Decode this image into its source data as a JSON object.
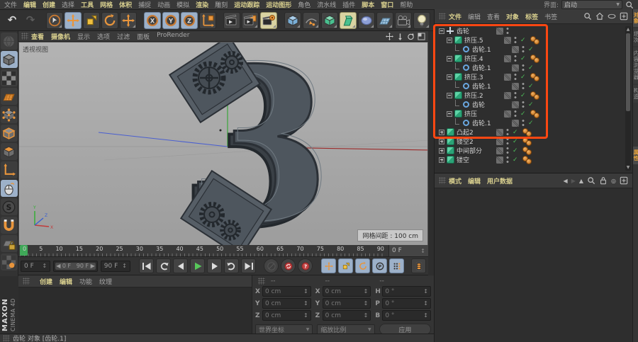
{
  "icons": {
    "undo": "↶",
    "redo": "↷",
    "stepper": "↕",
    "dropdown": "▼",
    "back": "◀",
    "forward": "▶",
    "up": "▲",
    "target": "◎",
    "range_left": "◀",
    "range_right": "▶"
  },
  "colors": {
    "accent": "#e8953c",
    "selection_blue": "#9db1c9",
    "annotation": "#ff4712",
    "check_green": "#4dbb58",
    "canvas_gray": "#a8a8a8"
  },
  "menubar": {
    "items": [
      {
        "label": "文件",
        "em": false
      },
      {
        "label": "编辑",
        "em": true
      },
      {
        "label": "创建",
        "em": true
      },
      {
        "label": "选择",
        "em": false
      },
      {
        "label": "工具",
        "em": true
      },
      {
        "label": "网格",
        "em": true
      },
      {
        "label": "体积",
        "em": true
      },
      {
        "label": "捕捉",
        "em": false
      },
      {
        "label": "动画",
        "em": false
      },
      {
        "label": "模拟",
        "em": false
      },
      {
        "label": "渲染",
        "em": true
      },
      {
        "label": "雕刻",
        "em": false
      },
      {
        "label": "运动跟踪",
        "em": true
      },
      {
        "label": "运动图形",
        "em": true
      },
      {
        "label": "角色",
        "em": false
      },
      {
        "label": "流水线",
        "em": false
      },
      {
        "label": "插件",
        "em": false
      },
      {
        "label": "脚本",
        "em": true
      },
      {
        "label": "窗口",
        "em": true
      },
      {
        "label": "帮助",
        "em": false
      }
    ],
    "interface_label": "界面:",
    "interface_value": "启动"
  },
  "toolbar": {
    "buttons": [
      {
        "name": "undo-button",
        "glyph": "↶",
        "plain": true
      },
      {
        "name": "redo-button",
        "glyph": "↷",
        "plain": true,
        "dim": true
      },
      {
        "name": "live-selection-button",
        "icon": "cursor",
        "gap": true,
        "fly": true
      },
      {
        "name": "move-button",
        "icon": "move",
        "active": true
      },
      {
        "name": "scale-button",
        "icon": "scale"
      },
      {
        "name": "rotate-button",
        "icon": "rotate"
      },
      {
        "name": "last-tool-button",
        "icon": "move",
        "fly": true
      },
      {
        "name": "lock-x-button",
        "icon": "axisX",
        "active": true,
        "gap": true
      },
      {
        "name": "lock-y-button",
        "icon": "axisY",
        "active": true
      },
      {
        "name": "lock-z-button",
        "icon": "axisZ",
        "active": true
      },
      {
        "name": "coord-system-button",
        "icon": "coordsys"
      },
      {
        "name": "render-view-button",
        "icon": "clapper",
        "gap": true
      },
      {
        "name": "render-picture-viewer-button",
        "icon": "clapperPV",
        "fly": true
      },
      {
        "name": "render-settings-button",
        "icon": "clapperRS",
        "warm": true,
        "fly": true
      },
      {
        "name": "add-primitive-button",
        "icon": "cubeBlue",
        "gap": true,
        "fly": true
      },
      {
        "name": "add-spline-button",
        "icon": "pen",
        "fly": true
      },
      {
        "name": "add-generator-button",
        "icon": "cubeGreen",
        "fly": true
      },
      {
        "name": "add-deformer-button",
        "icon": "deformer",
        "warm": true,
        "fly": true
      },
      {
        "name": "add-field-button",
        "icon": "field",
        "fly": true
      },
      {
        "name": "add-floor-button",
        "icon": "floor",
        "fly": true
      },
      {
        "name": "add-camera-button",
        "icon": "camera",
        "fly": true
      },
      {
        "name": "add-light-button",
        "icon": "light",
        "fly": true
      }
    ]
  },
  "left_palette": {
    "items": [
      {
        "name": "make-editable-button",
        "icon": "ballDim"
      },
      {
        "name": "model-mode-button",
        "icon": "cubeGray",
        "active": true
      },
      {
        "name": "texture-mode-button",
        "icon": "checker"
      },
      {
        "name": "workplane-mode-button",
        "icon": "wplane"
      },
      {
        "name": "points-mode-button",
        "icon": "cubePts"
      },
      {
        "name": "edges-mode-button",
        "icon": "cubeEdge"
      },
      {
        "name": "polygons-mode-button",
        "icon": "cubeFace"
      },
      {
        "name": "enable-axis-button",
        "icon": "axisL"
      },
      {
        "name": "viewport-solo-button",
        "icon": "mouse",
        "active": true
      },
      {
        "name": "enable-snap-button",
        "icon": "sball"
      },
      {
        "name": "magnet-button",
        "icon": "magnet"
      },
      {
        "name": "lock-workplane-button",
        "icon": "lockgrid"
      },
      {
        "name": "paint-setup-button",
        "icon": "paint"
      }
    ]
  },
  "viewport": {
    "menu": [
      {
        "label": "查看",
        "em": true
      },
      {
        "label": "摄像机",
        "em": true
      },
      {
        "label": "显示",
        "em": false
      },
      {
        "label": "选项",
        "em": false
      },
      {
        "label": "过滤",
        "em": false
      },
      {
        "label": "面板",
        "em": false
      },
      {
        "label": "ProRender",
        "em": false
      }
    ],
    "view_label": "透视视图",
    "grid_label": "网格间距 : 100 cm"
  },
  "timeline": {
    "ticks": [
      "0",
      "5",
      "10",
      "15",
      "20",
      "25",
      "30",
      "35",
      "40",
      "45",
      "50",
      "55",
      "60",
      "65",
      "70",
      "75",
      "80",
      "85",
      "90"
    ],
    "end_value": "0 F"
  },
  "transport": {
    "current": "0 F",
    "range_start": "0 F",
    "range_end": "90 F",
    "duration": "90 F",
    "buttons": [
      {
        "name": "goto-start-button",
        "icon": "tStart"
      },
      {
        "name": "goto-prev-key-button",
        "icon": "tPrevKey"
      },
      {
        "name": "prev-frame-button",
        "icon": "tPrev"
      },
      {
        "name": "play-button",
        "icon": "tPlay"
      },
      {
        "name": "next-frame-button",
        "icon": "tNext"
      },
      {
        "name": "goto-next-key-button",
        "icon": "tNextKey"
      },
      {
        "name": "goto-end-button",
        "icon": "tEnd"
      }
    ],
    "toggles": [
      {
        "name": "record-disabled-button",
        "icon": "recOff"
      },
      {
        "name": "autokey-button",
        "icon": "recOn"
      },
      {
        "name": "keyframe-help-button",
        "icon": "recQ"
      }
    ],
    "modes": [
      {
        "name": "key-position-button",
        "icon": "move",
        "blue": true
      },
      {
        "name": "key-scale-button",
        "icon": "scale",
        "blue": true
      },
      {
        "name": "key-rotation-button",
        "icon": "rotate",
        "blue": true
      },
      {
        "name": "key-parameter-button",
        "icon": "param",
        "blue": true
      },
      {
        "name": "key-pla-button",
        "icon": "pla",
        "blue": true
      }
    ]
  },
  "object_manager": {
    "menu": [
      {
        "label": "文件",
        "em": true
      },
      {
        "label": "编辑",
        "em": false
      },
      {
        "label": "查看",
        "em": false
      },
      {
        "label": "对象",
        "em": true
      },
      {
        "label": "标签",
        "em": true
      },
      {
        "label": "书签",
        "em": false
      }
    ],
    "tree": [
      {
        "label": "齿轮",
        "depth": 0,
        "type": "nul",
        "exp": "minus",
        "check": false,
        "tags": false
      },
      {
        "label": "挤压.5",
        "depth": 1,
        "type": "extrude",
        "exp": "minus",
        "check": true,
        "tags": true
      },
      {
        "label": "齿轮.1",
        "depth": 2,
        "type": "spline",
        "exp": "child",
        "check": true,
        "tags": false
      },
      {
        "label": "挤压.4",
        "depth": 1,
        "type": "extrude",
        "exp": "minus",
        "check": true,
        "tags": true
      },
      {
        "label": "齿轮.1",
        "depth": 2,
        "type": "spline",
        "exp": "child",
        "check": true,
        "tags": false
      },
      {
        "label": "挤压.3",
        "depth": 1,
        "type": "extrude",
        "exp": "minus",
        "check": true,
        "tags": true
      },
      {
        "label": "齿轮.1",
        "depth": 2,
        "type": "spline",
        "exp": "child",
        "check": true,
        "tags": false
      },
      {
        "label": "挤压.2",
        "depth": 1,
        "type": "extrude",
        "exp": "minus",
        "check": true,
        "tags": true
      },
      {
        "label": "齿轮",
        "depth": 2,
        "type": "spline",
        "exp": "child",
        "check": true,
        "tags": false
      },
      {
        "label": "挤压",
        "depth": 1,
        "type": "extrude",
        "exp": "minus",
        "check": true,
        "tags": true
      },
      {
        "label": "齿轮.1",
        "depth": 2,
        "type": "spline",
        "exp": "child",
        "check": true,
        "tags": false
      },
      {
        "label": "凸起2",
        "depth": 0,
        "type": "extrude",
        "exp": "plus",
        "check": true,
        "tags": true
      },
      {
        "label": "镂空2",
        "depth": 0,
        "type": "extrude",
        "exp": "plus",
        "check": true,
        "tags": true
      },
      {
        "label": "中间部分",
        "depth": 0,
        "type": "extrude",
        "exp": "plus",
        "check": true,
        "tags": true
      },
      {
        "label": "镂空",
        "depth": 0,
        "type": "extrude",
        "exp": "plus",
        "check": true,
        "tags": true
      }
    ]
  },
  "attribute_manager": {
    "menu": [
      {
        "label": "模式",
        "em": true
      },
      {
        "label": "编辑",
        "em": true
      },
      {
        "label": "用户数据",
        "em": true
      }
    ]
  },
  "material_manager": {
    "menu": [
      {
        "label": "创建",
        "em": true
      },
      {
        "label": "编辑",
        "em": true
      },
      {
        "label": "功能",
        "em": false
      },
      {
        "label": "纹理",
        "em": false
      }
    ]
  },
  "coords_manager": {
    "headers": [
      "--",
      "--",
      "--"
    ],
    "fields": [
      {
        "k": "X",
        "v": "0 cm"
      },
      {
        "k": "X",
        "v": "0 cm"
      },
      {
        "k": "H",
        "v": "0 °"
      },
      {
        "k": "Y",
        "v": "0 cm"
      },
      {
        "k": "Y",
        "v": "0 cm"
      },
      {
        "k": "P",
        "v": "0 °"
      },
      {
        "k": "Z",
        "v": "0 cm"
      },
      {
        "k": "Z",
        "v": "0 cm"
      },
      {
        "k": "B",
        "v": "0 °"
      }
    ],
    "dropdown1": "世界坐标",
    "dropdown2": "缩放比例",
    "apply_label": "应用"
  },
  "right_tabs": {
    "top": [
      {
        "label": "对象",
        "active": true
      },
      {
        "label": "场次",
        "active": false
      },
      {
        "label": "内容浏览器",
        "active": false
      },
      {
        "label": "构造",
        "active": false
      }
    ],
    "bottom": [
      {
        "label": "属性",
        "active": true
      }
    ]
  },
  "status": {
    "text": "齿轮 对象 [齿轮.1]"
  },
  "branding": {
    "maxon": "MAXON",
    "cinema": "CINEMA 4D"
  }
}
